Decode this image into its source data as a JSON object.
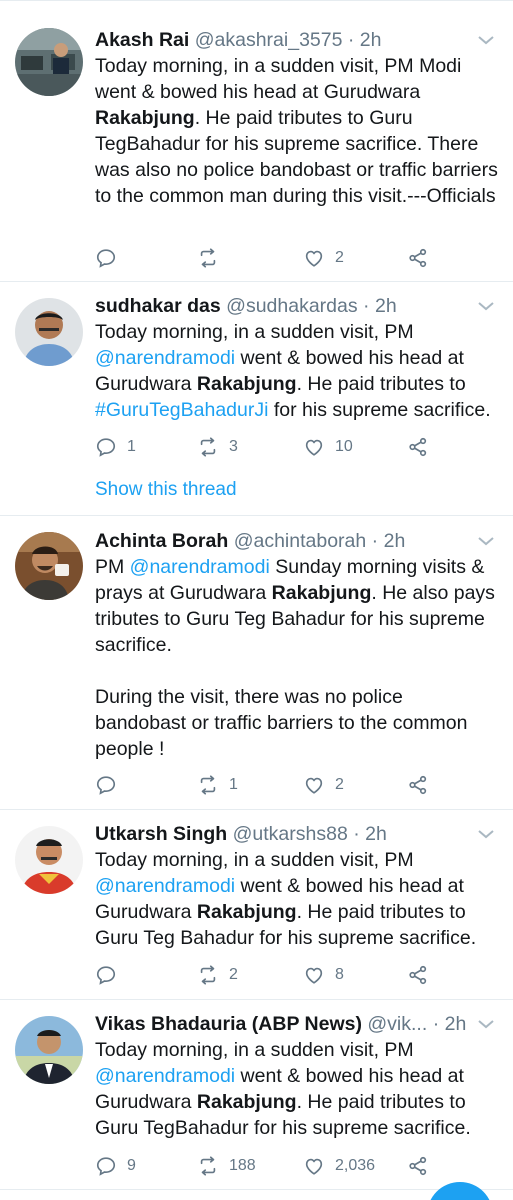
{
  "tweets": [
    {
      "name": "Akash Rai",
      "handle": "@akashrai_3575",
      "time": "2h",
      "segments": [
        {
          "t": "Today morning, in a sudden visit, PM Modi went & bowed his head at Gurudwara "
        },
        {
          "t": "Rakabjung",
          "b": true
        },
        {
          "t": ". He paid tributes to Guru TegBahadur for his supreme sacrifice. There was also no police bandobast or traffic barriers to the common man during this visit.---Officials"
        }
      ],
      "reply_count": "",
      "retweet_count": "",
      "like_count": "2"
    },
    {
      "name": "sudhakar das",
      "handle": "@sudhakardas",
      "time": "2h",
      "segments": [
        {
          "t": "Today morning, in a sudden visit, PM "
        },
        {
          "t": "@narendramodi",
          "link": true
        },
        {
          "t": "  went & bowed his head at Gurudwara "
        },
        {
          "t": "Rakabjung",
          "b": true
        },
        {
          "t": ". He paid tributes to "
        },
        {
          "t": "#GuruTegBahadurJi",
          "link": true
        },
        {
          "t": " for his supreme sacrifice."
        }
      ],
      "reply_count": "1",
      "retweet_count": "3",
      "like_count": "10",
      "show_thread": "Show this thread"
    },
    {
      "name": "Achinta Borah",
      "handle": "@achintaborah",
      "time": "2h",
      "segments": [
        {
          "t": "PM "
        },
        {
          "t": "@narendramodi",
          "link": true
        },
        {
          "t": " Sunday morning visits & prays at Gurudwara "
        },
        {
          "t": "Rakabjung",
          "b": true
        },
        {
          "t": ". He also pays tributes to Guru Teg Bahadur for his supreme sacrifice."
        },
        {
          "br": true
        },
        {
          "t": "During the visit, there was no police bandobast or traffic barriers to the common people !"
        }
      ],
      "reply_count": "",
      "retweet_count": "1",
      "like_count": "2"
    },
    {
      "name": "Utkarsh Singh",
      "handle": "@utkarshs88",
      "time": "2h",
      "segments": [
        {
          "t": "Today morning, in a sudden visit, PM "
        },
        {
          "t": "@narendramodi",
          "link": true
        },
        {
          "t": " went & bowed his head at Gurudwara "
        },
        {
          "t": "Rakabjung",
          "b": true
        },
        {
          "t": ". He paid tributes to Guru Teg Bahadur for his supreme sacrifice."
        }
      ],
      "reply_count": "",
      "retweet_count": "2",
      "like_count": "8"
    },
    {
      "name": "Vikas Bhadauria (ABP News)",
      "handle": "@vik...",
      "time": "2h",
      "segments": [
        {
          "t": "Today morning, in a sudden visit, PM "
        },
        {
          "t": "@narendramodi",
          "link": true
        },
        {
          "t": " went & bowed his head at Gurudwara "
        },
        {
          "t": "Rakabjung",
          "b": true
        },
        {
          "t": ". He paid tributes to Guru TegBahadur for his supreme sacrifice."
        }
      ],
      "reply_count": "9",
      "retweet_count": "188",
      "like_count": "2,036"
    }
  ],
  "icons": {
    "reply": "reply-icon",
    "retweet": "retweet-icon",
    "like": "heart-icon",
    "share": "share-icon",
    "menu": "chevron-down-icon"
  },
  "colors": {
    "link": "#1da1f2",
    "secondary_text": "#657786",
    "divider": "#e6ecf0"
  }
}
